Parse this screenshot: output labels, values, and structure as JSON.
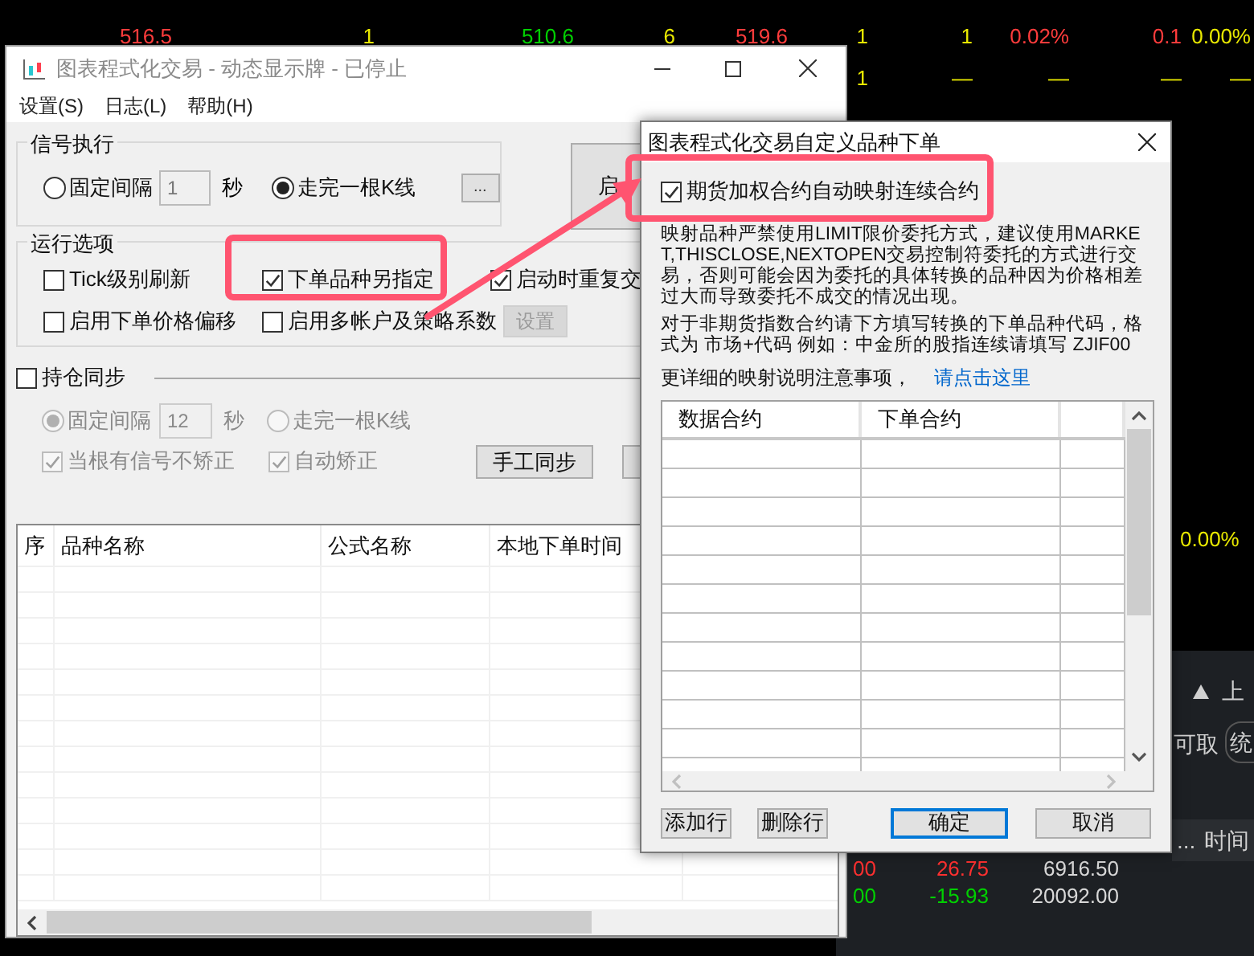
{
  "market_board": {
    "rows": [
      {
        "cells": [
          {
            "text": "516.5",
            "color": "#ff3c3c"
          },
          {
            "text": "1",
            "color": "#e8e800"
          },
          {
            "text": "510.6",
            "color": "#00d000"
          },
          {
            "text": "6",
            "color": "#e8e800"
          },
          {
            "text": "519.6",
            "color": "#ff3c3c"
          },
          {
            "text": "1",
            "color": "#e8e800"
          },
          {
            "text": "1",
            "color": "#e8e800"
          },
          {
            "text": "0.02%",
            "color": "#ff3c3c"
          },
          {
            "text": "0.1",
            "color": "#ff3c3c"
          },
          {
            "text": "0.00%",
            "color": "#e8e800"
          }
        ]
      },
      {
        "cells": [
          {
            "text": ""
          },
          {
            "text": ""
          },
          {
            "text": ""
          },
          {
            "text": ""
          },
          {
            "text": ""
          },
          {
            "text": "1",
            "color": "#e8e800"
          },
          {
            "text": "—",
            "color": "#e8e800"
          },
          {
            "text": "—",
            "color": "#e8e800"
          },
          {
            "text": "—",
            "color": "#e8e800"
          },
          {
            "text": "—",
            "color": "#e8e800"
          }
        ]
      }
    ],
    "side_value": {
      "text": "0.00%",
      "color": "#e8e800"
    }
  },
  "account_panel": {
    "tab": "上",
    "label": "可取",
    "pill": "统",
    "columns": [
      "...",
      "时间"
    ],
    "rows": [
      {
        "cells": [
          {
            "text": "00",
            "color": "#ff3030"
          },
          {
            "text": "26.75",
            "color": "#ff3030"
          },
          {
            "text": "6916.50",
            "color": "#d8d8d8"
          }
        ]
      },
      {
        "cells": [
          {
            "text": "00",
            "color": "#00d000"
          },
          {
            "text": "-15.93",
            "color": "#00d000"
          },
          {
            "text": "20092.00",
            "color": "#d8d8d8"
          }
        ]
      }
    ]
  },
  "main_window": {
    "title": "图表程式化交易 - 动态显示牌 - 已停止",
    "menu": [
      "设置(S)",
      "日志(L)",
      "帮助(H)"
    ],
    "signal_execution": {
      "title": "信号执行",
      "modes": [
        {
          "label": "固定间隔",
          "selected": false
        },
        {
          "label": "走完一根K线",
          "selected": true
        }
      ],
      "interval_value": "1",
      "unit": "秒",
      "more_button": "...",
      "start_button": "启"
    },
    "run_options": {
      "title": "运行选项",
      "options": [
        {
          "label": "Tick级别刷新",
          "checked": false
        },
        {
          "label": "下单品种另指定",
          "checked": true
        },
        {
          "label": "启动时重复交",
          "checked": true
        },
        {
          "label": "启用下单价格偏移",
          "checked": false
        },
        {
          "label": "启用多帐户及策略系数",
          "checked": false
        }
      ],
      "settings_button": {
        "label": "设置",
        "disabled": true
      }
    },
    "position_sync": {
      "label": "持仓同步",
      "checked": false,
      "disabled": true,
      "modes": [
        {
          "label": "固定间隔",
          "selected": true
        },
        {
          "label": "走完一根K线",
          "selected": false
        }
      ],
      "interval_value": "12",
      "unit": "秒",
      "options": [
        {
          "label": "当根有信号不矫正",
          "checked": true
        },
        {
          "label": "自动矫正",
          "checked": true
        }
      ],
      "sync_button": "手工同步"
    },
    "order_table": {
      "columns": [
        "序",
        "品种名称",
        "公式名称",
        "本地下单时间"
      ]
    }
  },
  "dialog": {
    "title": "图表程式化交易自定义品种下单",
    "auto_map": {
      "label": "期货加权合约自动映射连续合约",
      "checked": true
    },
    "warning": "映射品种严禁使用LIMIT限价委托方式，建议使用MARKET,THISCLOSE,NEXTOPEN交易控制符委托的方式进行交易，否则可能会因为委托的具体转换的品种因为价格相差过大而导致委托不成交的情况出现。",
    "instruction": "对于非期货指数合约请下方填写转换的下单品种代码，格式为 市场+代码 例如：中金所的股指连续请填写 ZJIF00",
    "details_text": "更详细的映射说明注意事项，",
    "details_link": "请点击这里",
    "mapping_table": {
      "columns": [
        "数据合约",
        "下单合约"
      ]
    },
    "buttons": [
      {
        "label": "添加行",
        "focused": false
      },
      {
        "label": "删除行",
        "focused": false
      },
      {
        "label": "确定",
        "focused": true
      },
      {
        "label": "取消",
        "focused": false
      }
    ]
  }
}
